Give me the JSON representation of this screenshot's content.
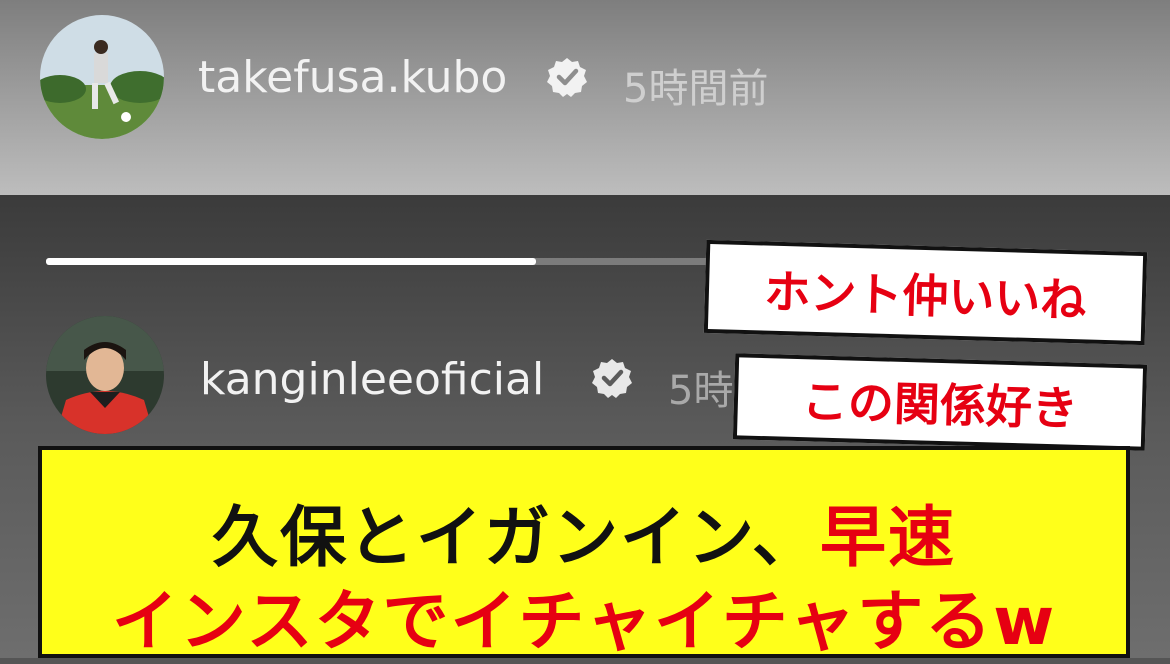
{
  "posts": [
    {
      "username": "takefusa.kubo",
      "time": "5時間前",
      "verified": true,
      "avatar_icon": "player-photo"
    },
    {
      "username": "kanginleeoficial",
      "time": "5時",
      "verified": true,
      "avatar_icon": "player-photo"
    }
  ],
  "story": {
    "progress": 0.7
  },
  "comments": [
    "ホント仲いいね",
    "この関係好き"
  ],
  "caption": {
    "line1_black": "久保とイガンイン、",
    "line1_red": "早速",
    "line2": "インスタでイチャイチャするw"
  },
  "colors": {
    "caption_bg": "#ffff1a",
    "accent_red": "#e60012",
    "bubble_bg": "#ffffff"
  }
}
